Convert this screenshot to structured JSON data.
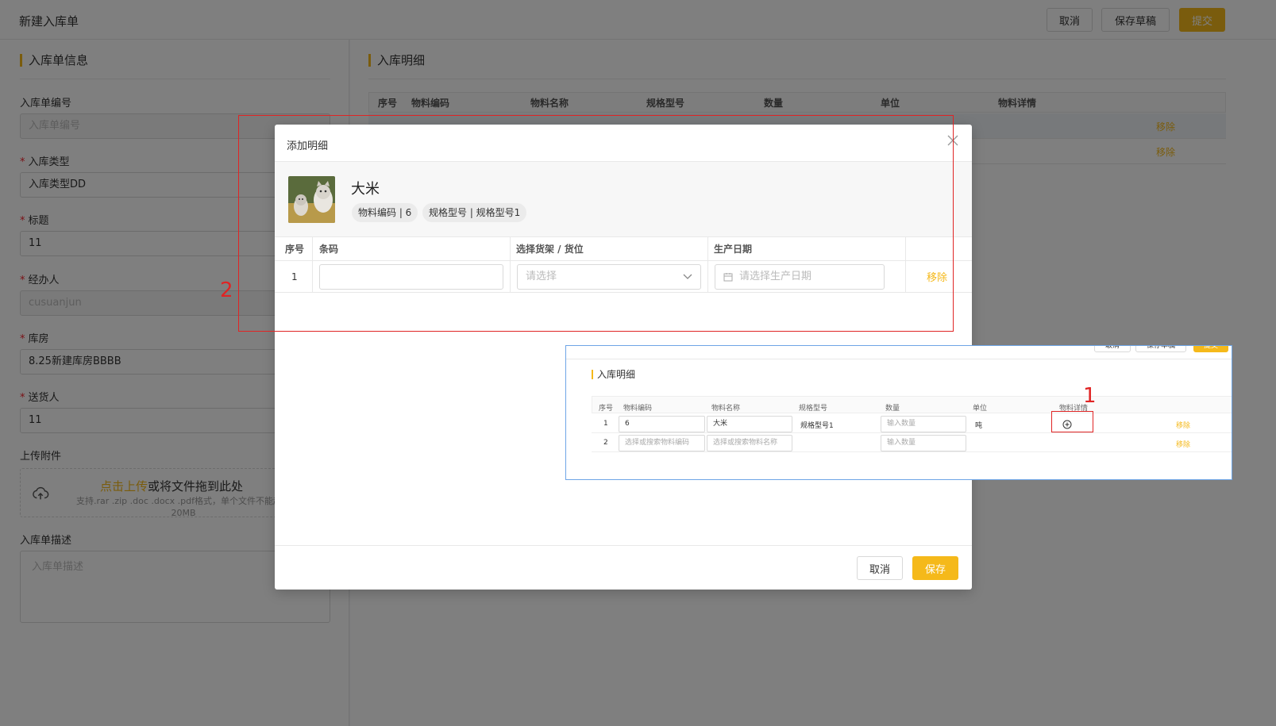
{
  "page": {
    "title": "新建入库单",
    "cancel_label": "取消",
    "save_draft_label": "保存草稿",
    "submit_label": "提交"
  },
  "left": {
    "section_title": "入库单信息",
    "fields": [
      {
        "label": "入库单编号",
        "required": false,
        "value": "",
        "placeholder": "入库单编号"
      },
      {
        "label": "入库类型",
        "required": true,
        "value": "入库类型DD"
      },
      {
        "label": "标题",
        "required": true,
        "value": "11"
      },
      {
        "label": "经办人",
        "required": true,
        "value": "cusuanjun"
      },
      {
        "label": "库房",
        "required": true,
        "value": "8.25新建库房BBBB"
      },
      {
        "label": "送货人",
        "required": true,
        "value": "11"
      }
    ],
    "upload_label": "上传附件",
    "upload_link": "点击上传",
    "upload_text": "或将文件拖到此处",
    "upload_hint": "支持.rar .zip .doc .docx .pdf格式，单个文件不能超过20MB",
    "desc_label": "入库单描述",
    "desc_placeholder": "入库单描述"
  },
  "right": {
    "section_title": "入库明细",
    "columns": [
      "序号",
      "物料编码",
      "物料名称",
      "规格型号",
      "数量",
      "单位",
      "物料详情"
    ],
    "row1_partial": [
      "1",
      "6",
      "大米",
      "规格型号1",
      "输入数量",
      "吨"
    ],
    "remove_label": "移除"
  },
  "modal": {
    "title": "添加明细",
    "product_name": "大米",
    "tag_code": "物料编码 | 6",
    "tag_spec": "规格型号 | 规格型号1",
    "columns": [
      "序号",
      "条码",
      "选择货架 / 货位",
      "生产日期"
    ],
    "row_index": "1",
    "shelf_placeholder": "请选择",
    "date_placeholder": "请选择生产日期",
    "remove_label": "移除",
    "cancel_label": "取消",
    "save_label": "保存"
  },
  "annotations": {
    "label_1": "1",
    "label_2": "2"
  },
  "inset": {
    "btn_cancel": "取消",
    "btn_draft": "保存草稿",
    "btn_submit": "提交",
    "section_title": "入库明细",
    "columns": [
      "序号",
      "物料编码",
      "物料名称",
      "规格型号",
      "数量",
      "单位",
      "物料详情"
    ],
    "rows": [
      {
        "index": "1",
        "code": "6",
        "name": "大米",
        "spec": "规格型号1",
        "qty_placeholder": "输入数量",
        "unit": "吨",
        "remove": "移除"
      },
      {
        "index": "2",
        "code_placeholder": "选择或搜索物料编码",
        "name_placeholder": "选择或搜索物料名称",
        "qty_placeholder": "输入数量",
        "remove": "移除"
      }
    ]
  },
  "colors": {
    "accent": "#f5b91a",
    "annotation": "#e02424",
    "inset_border": "#6ea5e6"
  }
}
